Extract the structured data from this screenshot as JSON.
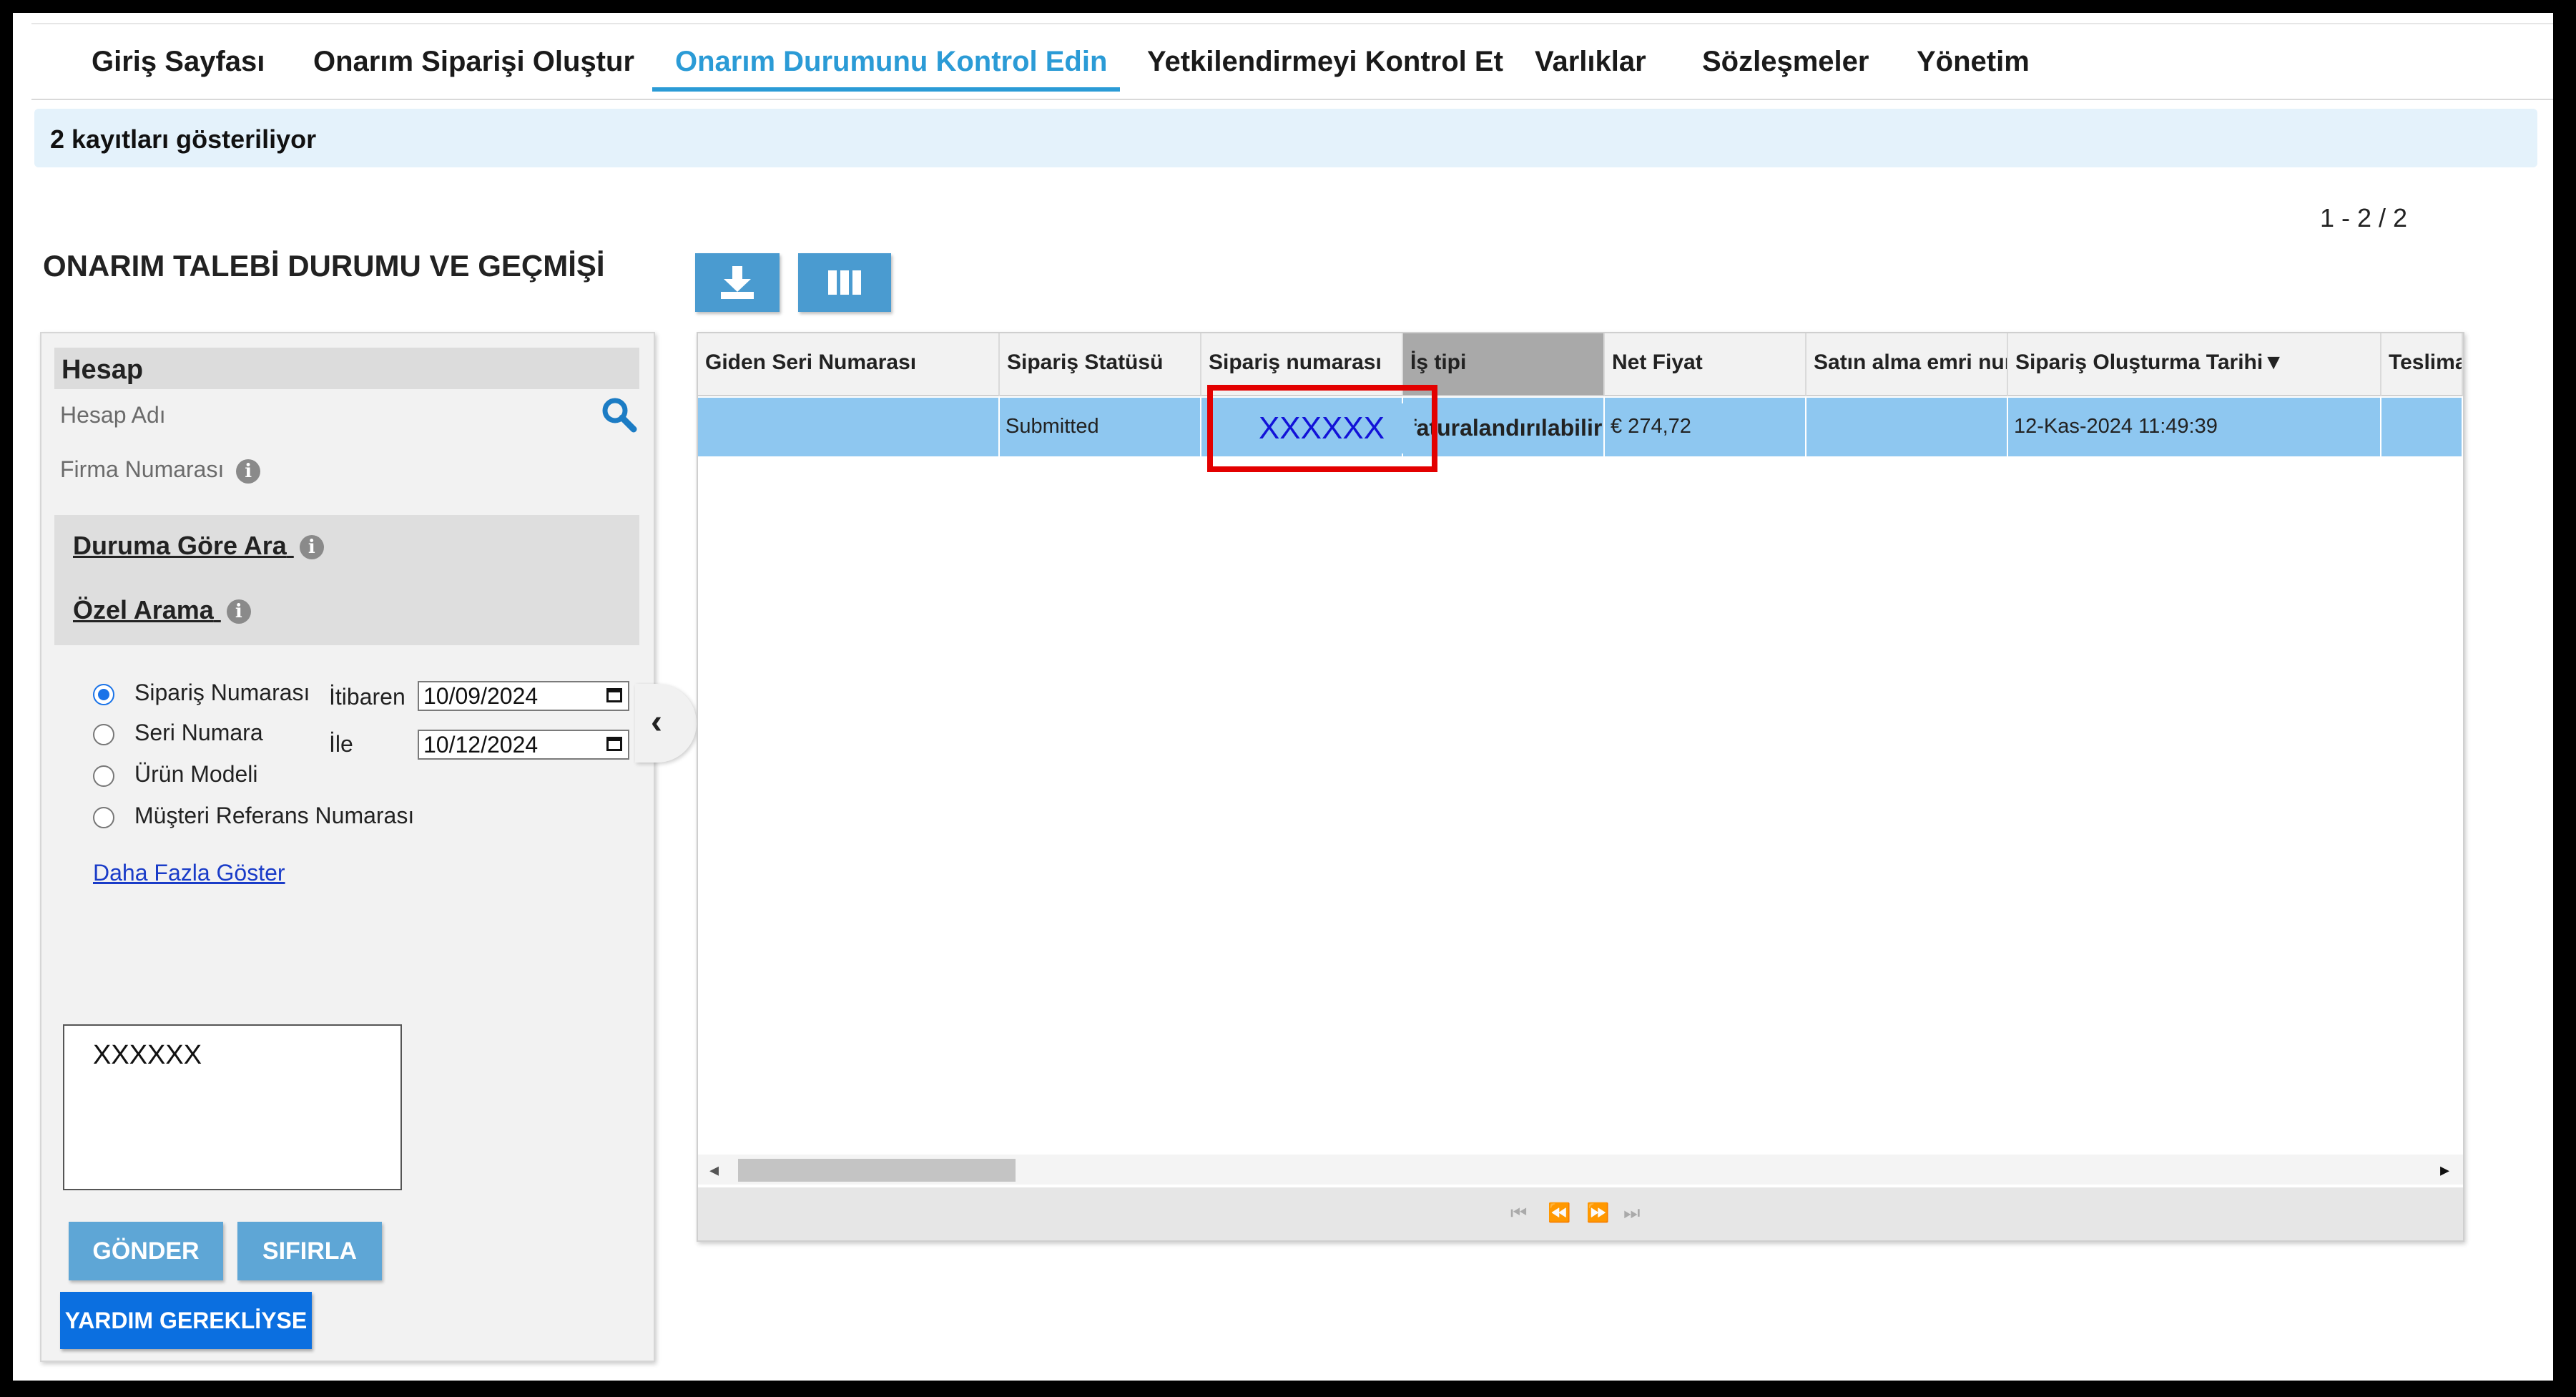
{
  "nav": {
    "items": [
      {
        "label": "Giriş Sayfası"
      },
      {
        "label": "Onarım Siparişi Oluştur"
      },
      {
        "label": "Onarım Durumunu Kontrol Edin",
        "active": true
      },
      {
        "label": "Yetkilendirmeyi Kontrol Et"
      },
      {
        "label": "Varlıklar"
      },
      {
        "label": "Sözleşmeler"
      },
      {
        "label": "Yönetim"
      }
    ]
  },
  "info_bar": "2 kayıtları gösteriliyor",
  "pager_count": "1 - 2 / 2",
  "page_title": "ONARIM TALEBİ DURUMU VE GEÇMİŞİ",
  "left_panel": {
    "section_title": "Hesap",
    "account_name_label": "Hesap Adı",
    "company_number_label": "Firma Numarası",
    "search_by_status": "Duruma Göre Ara",
    "custom_search": "Özel Arama",
    "radio_options": [
      {
        "label": "Sipariş Numarası",
        "selected": true
      },
      {
        "label": "Seri Numara",
        "selected": false
      },
      {
        "label": "Ürün Modeli",
        "selected": false
      },
      {
        "label": "Müşteri Referans Numarası",
        "selected": false
      }
    ],
    "from_label": "İtibaren",
    "from_date": "10/09/2024",
    "to_label": "İle",
    "to_date": "10/12/2024",
    "show_more": "Daha Fazla Göster",
    "search_text": "XXXXXX",
    "submit_label": "GÖNDER",
    "reset_label": "SIFIRLA",
    "help_label": "YARDIM GEREKLİYSE"
  },
  "grid": {
    "columns": [
      "Giden Seri Numarası",
      "Sipariş Statüsü",
      "Sipariş numarası",
      "İş tipi",
      "Net Fiyat",
      "Satın alma emri numarası",
      "Sipariş Oluşturma Tarihi▼",
      "Teslimat"
    ],
    "rows": [
      {
        "serial": "",
        "status": "Submitted",
        "order_number": "XXXXXX",
        "job_type": "faturalandırılabilir",
        "net_price": "€ 274,72",
        "po_number": "",
        "created": "12-Kas-2024 11:49:39",
        "delivery": ""
      }
    ]
  },
  "colors": {
    "accent": "#2b9bd6",
    "selected_row": "#8ec7f0",
    "highlight": "#e30000",
    "button": "#5ea6d6",
    "primary_button": "#0b6fe0"
  }
}
